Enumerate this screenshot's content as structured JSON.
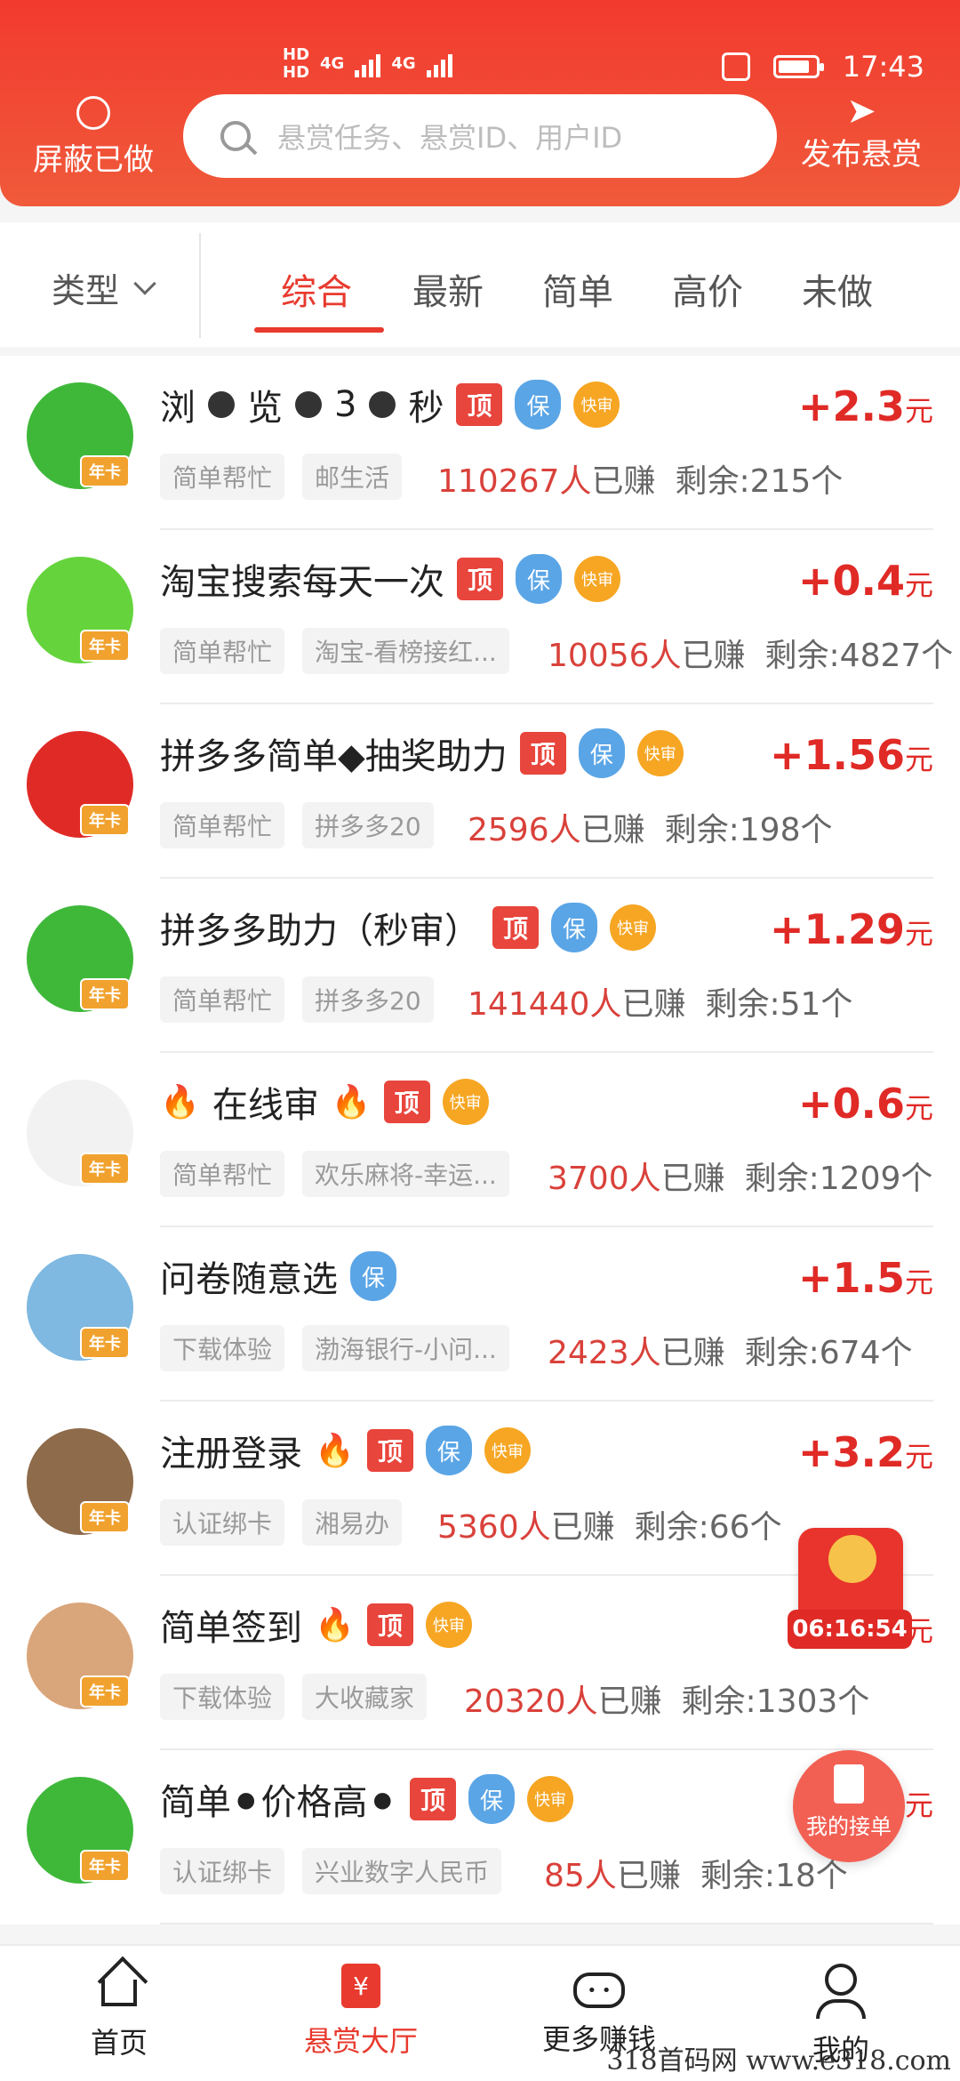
{
  "status_bar": {
    "left_tags": [
      "HD",
      "HD"
    ],
    "network": [
      "4G",
      "4G"
    ],
    "time": "17:43"
  },
  "header": {
    "shield_label": "屏蔽已做",
    "search_placeholder": "悬赏任务、悬赏ID、用户ID",
    "publish_label": "发布悬赏"
  },
  "filters": {
    "type_label": "类型",
    "tabs": [
      "综合",
      "最新",
      "简单",
      "高价",
      "未做"
    ],
    "active_tab": "综合"
  },
  "tasks": [
    {
      "title_parts": [
        "浏",
        "●",
        "览",
        "●",
        "3",
        "●",
        "秒"
      ],
      "title": "浏⚫览⚫3⚫秒",
      "badges": [
        "顶",
        "保",
        "快审"
      ],
      "tag1": "简单帮忙",
      "tag2": "邮生活",
      "earned": "110267人",
      "earned_suffix": "已赚",
      "remaining": "剩余:215个",
      "price": "+2.3",
      "unit": "元",
      "avatar_color": "#3fb83a",
      "crown": "年卡"
    },
    {
      "title": "淘宝搜索每天一次",
      "badges": [
        "顶",
        "保",
        "快审"
      ],
      "tag1": "简单帮忙",
      "tag2": "淘宝-看榜接红...",
      "earned": "10056人",
      "earned_suffix": "已赚",
      "remaining": "剩余:4827个",
      "price": "+0.4",
      "unit": "元",
      "avatar_color": "#65d43c",
      "crown": "年卡"
    },
    {
      "title": "拼多多简单◆抽奖助力",
      "badges": [
        "顶",
        "保",
        "快审"
      ],
      "tag1": "简单帮忙",
      "tag2": "拼多多20",
      "earned": "2596人",
      "earned_suffix": "已赚",
      "remaining": "剩余:198个",
      "price": "+1.56",
      "unit": "元",
      "avatar_color": "#e02a26",
      "crown": "年卡"
    },
    {
      "title": "拼多多助力（秒审）",
      "badges": [
        "顶",
        "保",
        "快审"
      ],
      "tag1": "简单帮忙",
      "tag2": "拼多多20",
      "earned": "141440人",
      "earned_suffix": "已赚",
      "remaining": "剩余:51个",
      "price": "+1.29",
      "unit": "元",
      "avatar_color": "#3fb83a",
      "crown": "年卡"
    },
    {
      "title": "在线审",
      "badges": [
        "顶",
        "快审"
      ],
      "tag1": "简单帮忙",
      "tag2": "欢乐麻将-幸运...",
      "earned": "3700人",
      "earned_suffix": "已赚",
      "remaining": "剩余:1209个",
      "price": "+0.6",
      "unit": "元",
      "avatar_color": "#f2f2f2",
      "crown": "年卡"
    },
    {
      "title": "问卷随意选",
      "badges": [
        "保"
      ],
      "tag1": "下载体验",
      "tag2": "渤海银行-小问...",
      "earned": "2423人",
      "earned_suffix": "已赚",
      "remaining": "剩余:674个",
      "price": "+1.5",
      "unit": "元",
      "avatar_color": "#7fb8e0",
      "crown": "年卡"
    },
    {
      "title": "注册登录",
      "badges": [
        "顶",
        "保",
        "快审"
      ],
      "tag1": "认证绑卡",
      "tag2": "湘易办",
      "earned": "5360人",
      "earned_suffix": "已赚",
      "remaining": "剩余:66个",
      "price": "+3.2",
      "unit": "元",
      "avatar_color": "#8e6b4a",
      "crown": "年卡"
    },
    {
      "title": "简单签到",
      "badges": [
        "顶",
        "快审"
      ],
      "tag1": "下载体验",
      "tag2": "大收藏家",
      "earned": "20320人",
      "earned_suffix": "已赚",
      "remaining": "剩余:1303个",
      "price": "",
      "unit": "元",
      "avatar_color": "#d9a57a",
      "crown": "年卡"
    },
    {
      "title": "简单⚫价格高⚫",
      "badges": [
        "顶",
        "保",
        "快审"
      ],
      "tag1": "认证绑卡",
      "tag2": "兴业数字人民币",
      "earned": "85人",
      "earned_suffix": "已赚",
      "remaining": "剩余:18个",
      "price": "",
      "unit": "元",
      "avatar_color": "#3fb83a",
      "crown": "年卡"
    }
  ],
  "floating": {
    "countdown": "06:16:54",
    "my_orders": "我的接单"
  },
  "bottom_nav": [
    {
      "label": "首页",
      "icon": "home-icon"
    },
    {
      "label": "悬赏大厅",
      "icon": "hall-icon",
      "active": true
    },
    {
      "label": "更多赚钱",
      "icon": "gamepad-icon"
    },
    {
      "label": "我的",
      "icon": "user-icon"
    }
  ],
  "watermark": "318首码网 www.e318.com",
  "colors": {
    "brand": "#e83a2e",
    "price": "#e02a26",
    "earned": "#d9413a"
  }
}
